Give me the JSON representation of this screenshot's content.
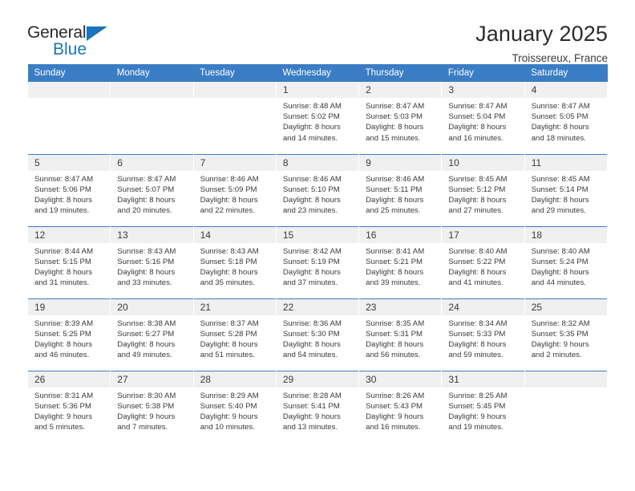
{
  "brand": {
    "word_one": "General",
    "word_two": "Blue",
    "triangle_icon": "triangle-right-icon",
    "accent_color": "#1b75bb"
  },
  "header": {
    "title": "January 2025",
    "location": "Troissereux, France"
  },
  "calendar": {
    "header_bg": "#3b7dc4",
    "daynum_bg": "#f0f0f0",
    "weekday_headers": [
      "Sunday",
      "Monday",
      "Tuesday",
      "Wednesday",
      "Thursday",
      "Friday",
      "Saturday"
    ],
    "labels": {
      "sunrise": "Sunrise:",
      "sunset": "Sunset:",
      "daylight": "Daylight:"
    },
    "weeks": [
      [
        {
          "day": "",
          "sunrise": "",
          "sunset": "",
          "daylight_1": "",
          "daylight_2": ""
        },
        {
          "day": "",
          "sunrise": "",
          "sunset": "",
          "daylight_1": "",
          "daylight_2": ""
        },
        {
          "day": "",
          "sunrise": "",
          "sunset": "",
          "daylight_1": "",
          "daylight_2": ""
        },
        {
          "day": "1",
          "sunrise": "Sunrise: 8:48 AM",
          "sunset": "Sunset: 5:02 PM",
          "daylight_1": "Daylight: 8 hours",
          "daylight_2": "and 14 minutes."
        },
        {
          "day": "2",
          "sunrise": "Sunrise: 8:47 AM",
          "sunset": "Sunset: 5:03 PM",
          "daylight_1": "Daylight: 8 hours",
          "daylight_2": "and 15 minutes."
        },
        {
          "day": "3",
          "sunrise": "Sunrise: 8:47 AM",
          "sunset": "Sunset: 5:04 PM",
          "daylight_1": "Daylight: 8 hours",
          "daylight_2": "and 16 minutes."
        },
        {
          "day": "4",
          "sunrise": "Sunrise: 8:47 AM",
          "sunset": "Sunset: 5:05 PM",
          "daylight_1": "Daylight: 8 hours",
          "daylight_2": "and 18 minutes."
        }
      ],
      [
        {
          "day": "5",
          "sunrise": "Sunrise: 8:47 AM",
          "sunset": "Sunset: 5:06 PM",
          "daylight_1": "Daylight: 8 hours",
          "daylight_2": "and 19 minutes."
        },
        {
          "day": "6",
          "sunrise": "Sunrise: 8:47 AM",
          "sunset": "Sunset: 5:07 PM",
          "daylight_1": "Daylight: 8 hours",
          "daylight_2": "and 20 minutes."
        },
        {
          "day": "7",
          "sunrise": "Sunrise: 8:46 AM",
          "sunset": "Sunset: 5:09 PM",
          "daylight_1": "Daylight: 8 hours",
          "daylight_2": "and 22 minutes."
        },
        {
          "day": "8",
          "sunrise": "Sunrise: 8:46 AM",
          "sunset": "Sunset: 5:10 PM",
          "daylight_1": "Daylight: 8 hours",
          "daylight_2": "and 23 minutes."
        },
        {
          "day": "9",
          "sunrise": "Sunrise: 8:46 AM",
          "sunset": "Sunset: 5:11 PM",
          "daylight_1": "Daylight: 8 hours",
          "daylight_2": "and 25 minutes."
        },
        {
          "day": "10",
          "sunrise": "Sunrise: 8:45 AM",
          "sunset": "Sunset: 5:12 PM",
          "daylight_1": "Daylight: 8 hours",
          "daylight_2": "and 27 minutes."
        },
        {
          "day": "11",
          "sunrise": "Sunrise: 8:45 AM",
          "sunset": "Sunset: 5:14 PM",
          "daylight_1": "Daylight: 8 hours",
          "daylight_2": "and 29 minutes."
        }
      ],
      [
        {
          "day": "12",
          "sunrise": "Sunrise: 8:44 AM",
          "sunset": "Sunset: 5:15 PM",
          "daylight_1": "Daylight: 8 hours",
          "daylight_2": "and 31 minutes."
        },
        {
          "day": "13",
          "sunrise": "Sunrise: 8:43 AM",
          "sunset": "Sunset: 5:16 PM",
          "daylight_1": "Daylight: 8 hours",
          "daylight_2": "and 33 minutes."
        },
        {
          "day": "14",
          "sunrise": "Sunrise: 8:43 AM",
          "sunset": "Sunset: 5:18 PM",
          "daylight_1": "Daylight: 8 hours",
          "daylight_2": "and 35 minutes."
        },
        {
          "day": "15",
          "sunrise": "Sunrise: 8:42 AM",
          "sunset": "Sunset: 5:19 PM",
          "daylight_1": "Daylight: 8 hours",
          "daylight_2": "and 37 minutes."
        },
        {
          "day": "16",
          "sunrise": "Sunrise: 8:41 AM",
          "sunset": "Sunset: 5:21 PM",
          "daylight_1": "Daylight: 8 hours",
          "daylight_2": "and 39 minutes."
        },
        {
          "day": "17",
          "sunrise": "Sunrise: 8:40 AM",
          "sunset": "Sunset: 5:22 PM",
          "daylight_1": "Daylight: 8 hours",
          "daylight_2": "and 41 minutes."
        },
        {
          "day": "18",
          "sunrise": "Sunrise: 8:40 AM",
          "sunset": "Sunset: 5:24 PM",
          "daylight_1": "Daylight: 8 hours",
          "daylight_2": "and 44 minutes."
        }
      ],
      [
        {
          "day": "19",
          "sunrise": "Sunrise: 8:39 AM",
          "sunset": "Sunset: 5:25 PM",
          "daylight_1": "Daylight: 8 hours",
          "daylight_2": "and 46 minutes."
        },
        {
          "day": "20",
          "sunrise": "Sunrise: 8:38 AM",
          "sunset": "Sunset: 5:27 PM",
          "daylight_1": "Daylight: 8 hours",
          "daylight_2": "and 49 minutes."
        },
        {
          "day": "21",
          "sunrise": "Sunrise: 8:37 AM",
          "sunset": "Sunset: 5:28 PM",
          "daylight_1": "Daylight: 8 hours",
          "daylight_2": "and 51 minutes."
        },
        {
          "day": "22",
          "sunrise": "Sunrise: 8:36 AM",
          "sunset": "Sunset: 5:30 PM",
          "daylight_1": "Daylight: 8 hours",
          "daylight_2": "and 54 minutes."
        },
        {
          "day": "23",
          "sunrise": "Sunrise: 8:35 AM",
          "sunset": "Sunset: 5:31 PM",
          "daylight_1": "Daylight: 8 hours",
          "daylight_2": "and 56 minutes."
        },
        {
          "day": "24",
          "sunrise": "Sunrise: 8:34 AM",
          "sunset": "Sunset: 5:33 PM",
          "daylight_1": "Daylight: 8 hours",
          "daylight_2": "and 59 minutes."
        },
        {
          "day": "25",
          "sunrise": "Sunrise: 8:32 AM",
          "sunset": "Sunset: 5:35 PM",
          "daylight_1": "Daylight: 9 hours",
          "daylight_2": "and 2 minutes."
        }
      ],
      [
        {
          "day": "26",
          "sunrise": "Sunrise: 8:31 AM",
          "sunset": "Sunset: 5:36 PM",
          "daylight_1": "Daylight: 9 hours",
          "daylight_2": "and 5 minutes."
        },
        {
          "day": "27",
          "sunrise": "Sunrise: 8:30 AM",
          "sunset": "Sunset: 5:38 PM",
          "daylight_1": "Daylight: 9 hours",
          "daylight_2": "and 7 minutes."
        },
        {
          "day": "28",
          "sunrise": "Sunrise: 8:29 AM",
          "sunset": "Sunset: 5:40 PM",
          "daylight_1": "Daylight: 9 hours",
          "daylight_2": "and 10 minutes."
        },
        {
          "day": "29",
          "sunrise": "Sunrise: 8:28 AM",
          "sunset": "Sunset: 5:41 PM",
          "daylight_1": "Daylight: 9 hours",
          "daylight_2": "and 13 minutes."
        },
        {
          "day": "30",
          "sunrise": "Sunrise: 8:26 AM",
          "sunset": "Sunset: 5:43 PM",
          "daylight_1": "Daylight: 9 hours",
          "daylight_2": "and 16 minutes."
        },
        {
          "day": "31",
          "sunrise": "Sunrise: 8:25 AM",
          "sunset": "Sunset: 5:45 PM",
          "daylight_1": "Daylight: 9 hours",
          "daylight_2": "and 19 minutes."
        },
        {
          "day": "",
          "sunrise": "",
          "sunset": "",
          "daylight_1": "",
          "daylight_2": ""
        }
      ]
    ]
  }
}
